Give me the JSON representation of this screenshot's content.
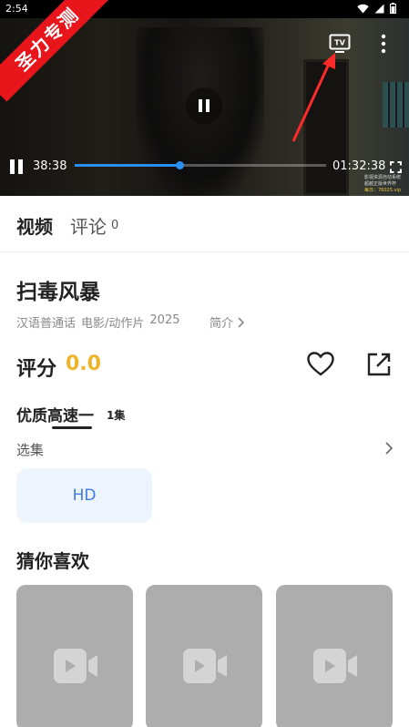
{
  "status_bar": {
    "time": "2:54"
  },
  "ribbon": {
    "text": "圣力专测"
  },
  "player": {
    "current_time": "38:38",
    "total_time": "01:32:38",
    "progress": 0.417,
    "watermark": [
      "影视资源自动系统",
      "超越正版世界杯",
      "每日：76025.vip"
    ]
  },
  "tabs": {
    "video": "视频",
    "comment": "评论",
    "comment_count": "0"
  },
  "detail": {
    "title": "扫毒风暴",
    "meta": [
      "汉语普通话",
      "电影/动作片",
      "2025"
    ],
    "intro_link": "简介",
    "rating_label": "评分",
    "rating_value": "0.0"
  },
  "source": {
    "name": "优质高速一",
    "count": "1集"
  },
  "episodes": {
    "label": "选集",
    "items": [
      "HD"
    ]
  },
  "recommend": {
    "title": "猜你喜欢",
    "cards": 3
  },
  "colors": {
    "accent": "#2b8ff0",
    "rating": "#f0b42a",
    "ribbon": "#e8151b",
    "episode_bg": "#edf4fe",
    "episode_text": "#3d7de0"
  },
  "icons": [
    "wifi-icon",
    "signal-icon",
    "battery-icon",
    "tv-cast-icon",
    "more-vertical-icon",
    "pause-icon",
    "fullscreen-icon",
    "heart-icon",
    "share-icon",
    "chevron-right-icon",
    "video-placeholder-icon"
  ]
}
